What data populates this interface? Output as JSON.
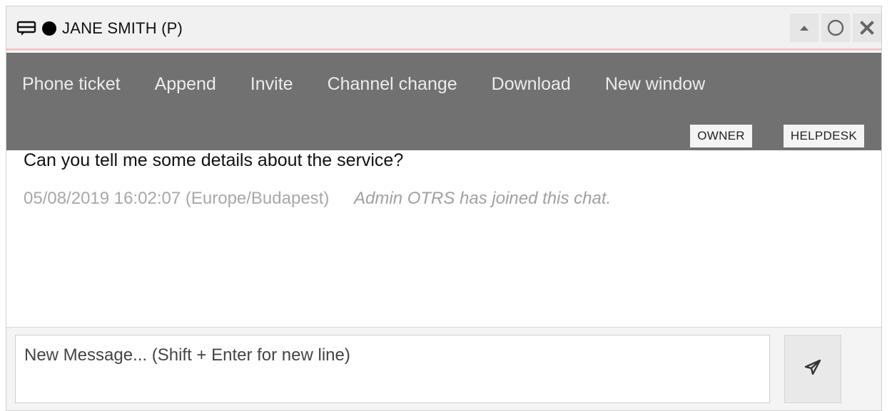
{
  "titlebar": {
    "chat_icon": "chat-bubbles-icon",
    "status_color": "#000000",
    "title": "JANE SMITH (P)",
    "controls": [
      {
        "name": "minimize-button",
        "icon": "triangle-up-icon"
      },
      {
        "name": "maximize-button",
        "icon": "circle-icon"
      },
      {
        "name": "close-button",
        "icon": "close-icon"
      }
    ]
  },
  "actions": {
    "phone_ticket": "Phone ticket",
    "append": "Append",
    "invite": "Invite",
    "channel_change": "Channel change",
    "download": "Download",
    "new_window": "New window"
  },
  "tags": {
    "owner": "OWNER",
    "helpdesk": "HELPDESK"
  },
  "messages": {
    "question": "Can you tell me some details about the service?",
    "system_time": "05/08/2019 16:02:07 (Europe/Budapest)",
    "system_note": "Admin OTRS has joined this chat."
  },
  "composer": {
    "placeholder": "New Message... (Shift + Enter for new line)",
    "value": "",
    "send_icon": "paper-plane-icon"
  },
  "colors": {
    "titlebar_bg": "#f1f1f1",
    "titlebar_accent": "#f2c4c4",
    "actionbar_bg": "#717171",
    "action_text": "#ececec",
    "muted_text": "#a8a8a8"
  }
}
